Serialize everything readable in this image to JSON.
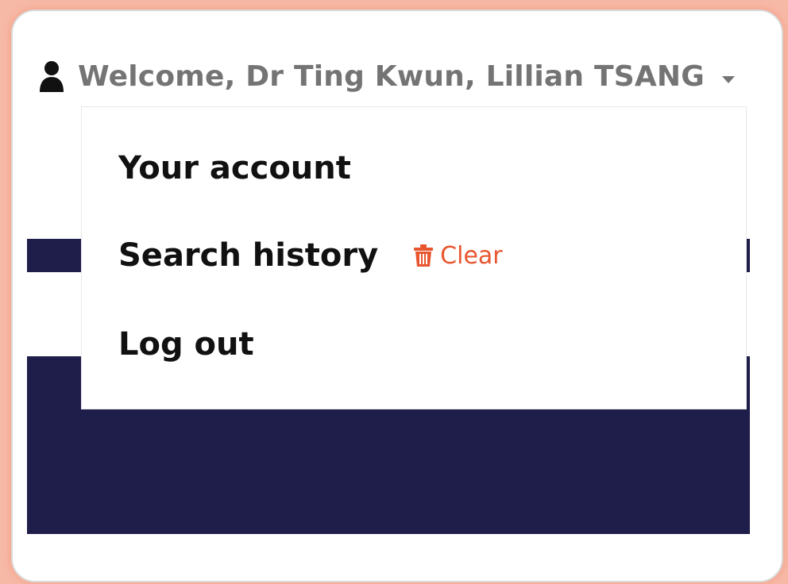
{
  "user_menu": {
    "welcome_text": "Welcome, Dr Ting Kwun, Lillian TSANG",
    "user_icon": "user-icon",
    "caret_icon": "caret-down-icon"
  },
  "dropdown": {
    "items": [
      {
        "label": "Your account"
      },
      {
        "label": "Search history"
      },
      {
        "label": "Log out"
      }
    ],
    "clear": {
      "label": "Clear",
      "icon": "trash-icon",
      "color": "#e8562f"
    }
  },
  "colors": {
    "navy": "#1f1e4b",
    "welcome_text": "#747474",
    "menu_text": "#111111"
  }
}
